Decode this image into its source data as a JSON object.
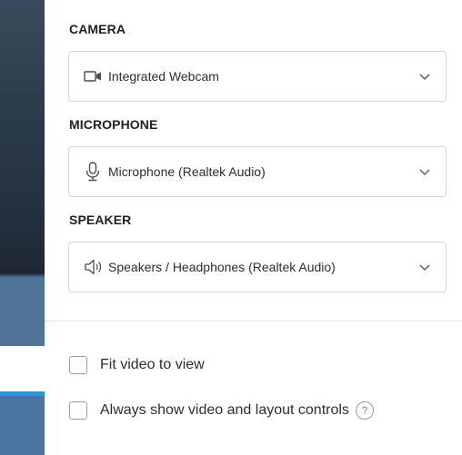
{
  "camera": {
    "title": "CAMERA",
    "selected": "Integrated Webcam",
    "icon": "video-camera-icon"
  },
  "microphone": {
    "title": "MICROPHONE",
    "selected": "Microphone (Realtek Audio)",
    "icon": "microphone-icon"
  },
  "speaker": {
    "title": "SPEAKER",
    "selected": "Speakers / Headphones (Realtek Audio)",
    "icon": "speaker-icon"
  },
  "options": {
    "fit_video_label": "Fit video to view",
    "always_show_label": "Always show video and layout controls",
    "help_glyph": "?"
  },
  "colors": {
    "accent": "#1e9be6",
    "border": "#d6d7da"
  }
}
